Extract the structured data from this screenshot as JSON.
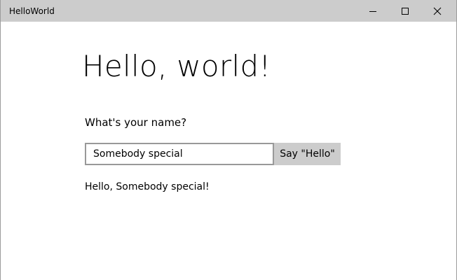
{
  "window": {
    "title": "HelloWorld",
    "titlebar_color": "#cccccc",
    "icons": {
      "minimize": "minimize-icon",
      "maximize": "maximize-icon",
      "close": "close-icon"
    }
  },
  "main": {
    "heading": "Hello, world!",
    "prompt": "What's your name?",
    "name_input": {
      "value": "Somebody special",
      "border_color": "#999999"
    },
    "say_button": {
      "label": "Say \"Hello\"",
      "background": "#cccccc"
    },
    "greeting": "Hello, Somebody special!"
  }
}
